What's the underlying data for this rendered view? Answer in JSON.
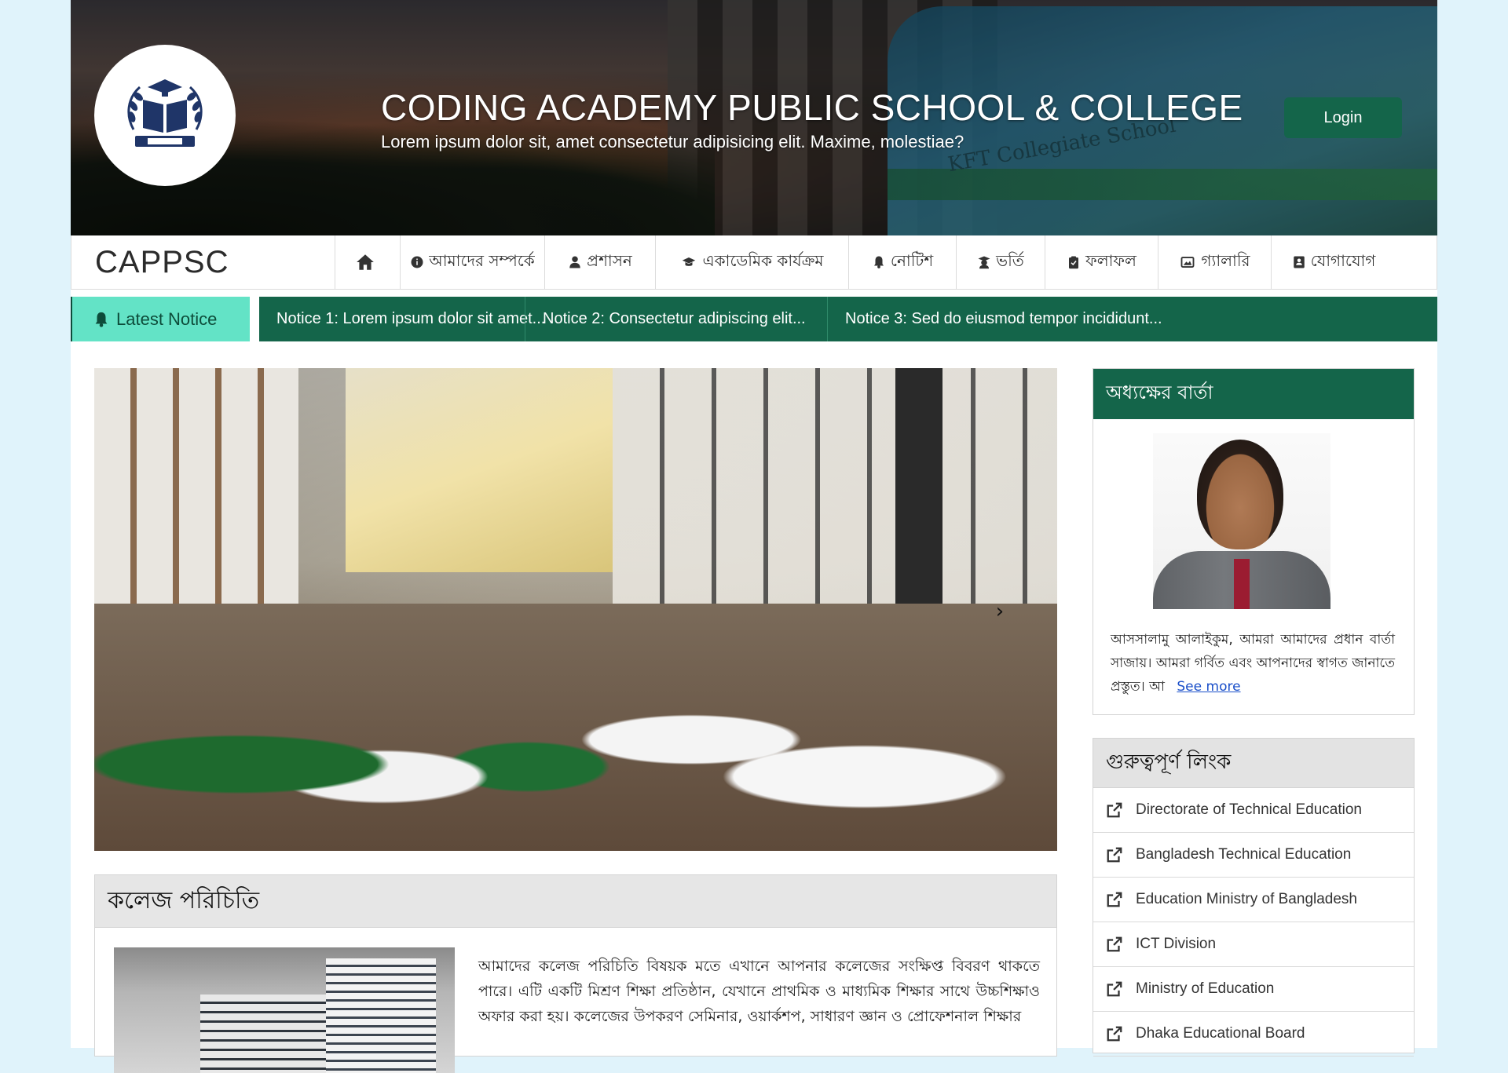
{
  "header": {
    "school_name": "CODING ACADEMY PUBLIC SCHOOL & COLLEGE",
    "tagline": "Lorem ipsum dolor sit, amet consectetur adipisicing elit. Maxime, molestiae?",
    "login_label": "Login",
    "logo_icon": "graduation-book-logo",
    "bus_text": "KFT Collegiate School"
  },
  "nav": {
    "brand": "CAPPSC",
    "items": [
      {
        "label": "",
        "icon": "home-icon"
      },
      {
        "label": "আমাদের সম্পর্কে",
        "icon": "info-icon"
      },
      {
        "label": "প্রশাসন",
        "icon": "user-tie-icon"
      },
      {
        "label": "একাডেমিক কার্যক্রম",
        "icon": "graduation-cap-icon"
      },
      {
        "label": "নোটিশ",
        "icon": "bell-icon"
      },
      {
        "label": "ভর্তি",
        "icon": "student-icon"
      },
      {
        "label": "ফলাফল",
        "icon": "clipboard-check-icon"
      },
      {
        "label": "গ্যালারি",
        "icon": "image-icon"
      },
      {
        "label": "যোগাযোগ",
        "icon": "contact-card-icon"
      }
    ]
  },
  "notice": {
    "label": "Latest Notice",
    "items": [
      "Notice 1: Lorem ipsum dolor sit amet...",
      "Notice 2: Consectetur adipiscing elit...",
      "Notice 3: Sed do eiusmod tempor incididunt..."
    ]
  },
  "slider": {
    "next_label": "›"
  },
  "intro": {
    "title": "কলেজ পরিচিতি",
    "text": "আমাদের কলেজ পরিচিতি বিষয়ক মতে এখানে আপনার কলেজের সংক্ষিপ্ত বিবরণ থাকতে পারে। এটি একটি মিশ্রণ শিক্ষা প্রতিষ্ঠান, যেখানে প্রাথমিক ও মাধ্যমিক শিক্ষার সাথে উচ্চশিক্ষাও অফার করা হয়। কলেজের উপকরণ সেমিনার, ওয়ার্কশপ, সাধারণ জ্ঞান ও প্রোফেশনাল শিক্ষার"
  },
  "principal": {
    "title": "অধ্যক্ষের বার্তা",
    "message": "আসসালামু আলাইকুম, আমরা আমাদের প্রধান বার্তা সাজায়। আমরা গর্বিত এবং আপনাদের স্বাগত জানাতে প্রস্তুত। আ",
    "see_more": "See more"
  },
  "links": {
    "title": "গুরুত্বপূর্ণ লিংক",
    "items": [
      "Directorate of Technical Education",
      "Bangladesh Technical Education",
      "Education Ministry of Bangladesh",
      "ICT Division",
      "Ministry of Education",
      "Dhaka Educational Board"
    ]
  },
  "colors": {
    "primary": "#14654a",
    "notice_label_bg": "#63e3c6",
    "page_bg": "#e0f3fb",
    "link": "#1a4fc9"
  }
}
